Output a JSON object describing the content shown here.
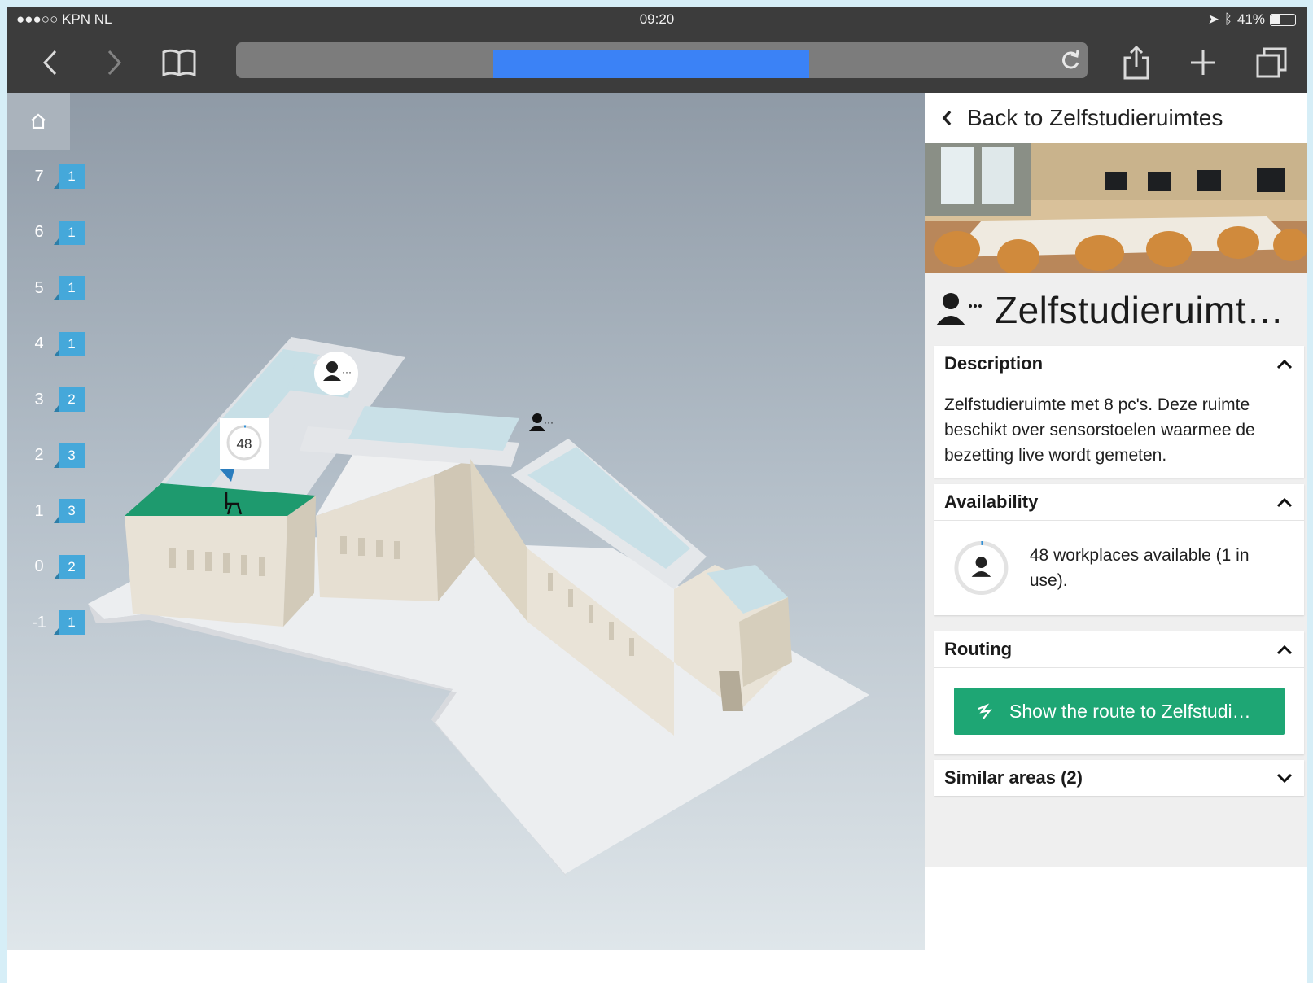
{
  "status_bar": {
    "carrier": "●●●○○ KPN NL",
    "time": "09:20",
    "battery": "41%",
    "battery_level": 0.41
  },
  "browser": {
    "address_loading_label": ""
  },
  "map": {
    "floors": [
      {
        "level": "7",
        "count": "1"
      },
      {
        "level": "6",
        "count": "1"
      },
      {
        "level": "5",
        "count": "1"
      },
      {
        "level": "4",
        "count": "1"
      },
      {
        "level": "3",
        "count": "2"
      },
      {
        "level": "2",
        "count": "3"
      },
      {
        "level": "1",
        "count": "3"
      },
      {
        "level": "0",
        "count": "2"
      },
      {
        "level": "-1",
        "count": "1"
      }
    ],
    "marker_count": "48",
    "colors": {
      "highlight": "#1e9a6e",
      "badge": "#45a8da"
    }
  },
  "panel": {
    "back_label": "Back to Zelfstudieruimtes",
    "title": "Zelfstudieruimt…",
    "description": {
      "heading": "Description",
      "text": "Zelfstudieruimte met 8 pc's. Deze ruimte beschikt over sensorstoelen waarmee de bezetting live wordt gemeten."
    },
    "availability": {
      "heading": "Availability",
      "text": "48 workplaces available (1 in use)."
    },
    "routing": {
      "heading": "Routing",
      "button_label": "Show the route to Zelfstudi…",
      "button_color": "#1ea674"
    },
    "similar": {
      "heading": "Similar areas (2)"
    }
  }
}
